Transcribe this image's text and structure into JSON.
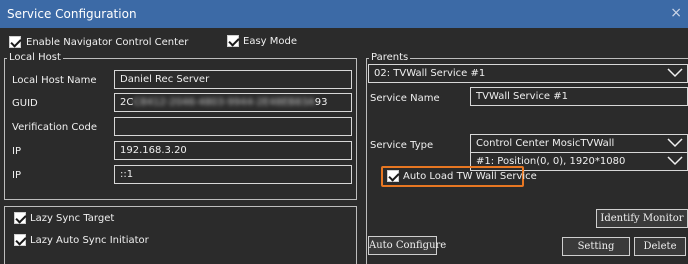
{
  "window": {
    "title": "Service Configuration",
    "close_glyph": "×"
  },
  "options": {
    "enable_navigator": {
      "label": "Enable Navigator Control Center",
      "checked": true
    },
    "easy_mode": {
      "label": "Easy Mode",
      "checked": true
    }
  },
  "local_host": {
    "group_title": "Local Host",
    "name_label": "Local Host Name",
    "name_value": "Daniel Rec Server",
    "guid_label": "GUID",
    "guid_prefix": "2C",
    "guid_blurred": "C8412-2046-4803-9944-2E48EB83A",
    "guid_suffix": "93",
    "verification_label": "Verification Code",
    "verification_value": "",
    "ip_label_1": "IP",
    "ip_value_1": "192.168.3.20",
    "ip_label_2": "IP",
    "ip_value_2": "::1"
  },
  "sync": {
    "lazy_sync_target": {
      "label": "Lazy Sync Target",
      "checked": true
    },
    "lazy_auto_sync": {
      "label": "Lazy Auto Sync Initiator",
      "checked": true
    }
  },
  "parents": {
    "group_title": "Parents",
    "selected": "02: TVWall Service #1",
    "service_name_label": "Service Name",
    "service_name_value": "TVWall Service #1",
    "service_type_label": "Service Type",
    "service_type_value": "Control Center MosicTVWall",
    "position_value": "#1: Position(0, 0), 1920*1080",
    "auto_load": {
      "label": "Auto Load TW Wall Service",
      "checked": true
    }
  },
  "buttons": {
    "identify_monitor": "Identify Monitor",
    "auto_configure": "Auto Configure",
    "setting": "Setting",
    "delete": "Delete"
  },
  "colors": {
    "titlebar": "#3c6aa6",
    "background": "#2b2b2b",
    "highlight": "#e87722"
  }
}
